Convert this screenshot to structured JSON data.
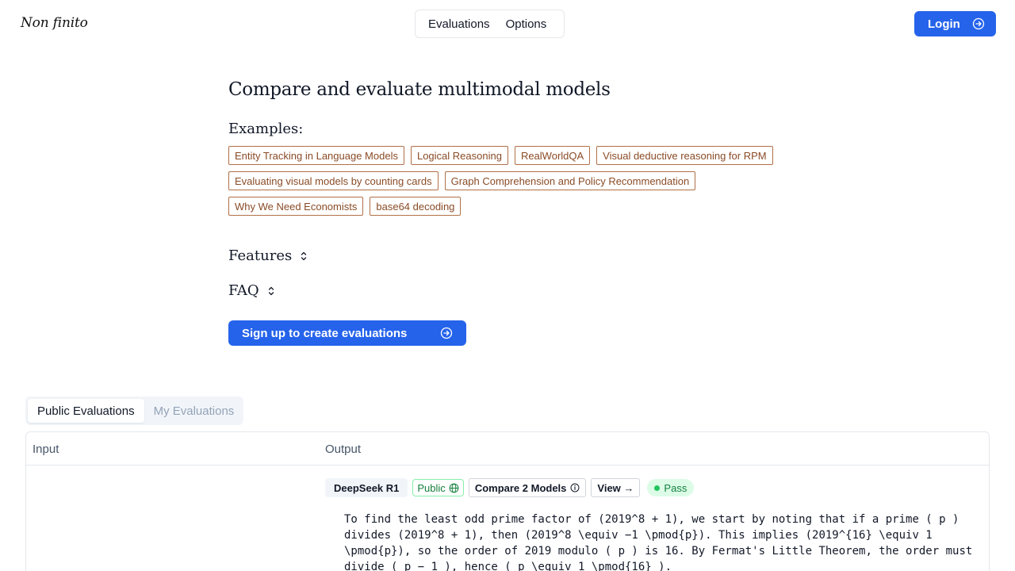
{
  "header": {
    "logo": "Non finito",
    "nav": [
      "Evaluations",
      "Options"
    ],
    "login_label": "Login"
  },
  "hero": {
    "title": "Compare and evaluate multimodal models",
    "examples_label": "Examples:",
    "examples": [
      "Entity Tracking in Language Models",
      "Logical Reasoning",
      "RealWorldQA",
      "Visual deductive reasoning for RPM",
      "Evaluating visual models by counting cards",
      "Graph Comprehension and Policy Recommendation",
      "Why We Need Economists",
      "base64 decoding"
    ],
    "features_label": "Features",
    "faq_label": "FAQ",
    "signup_label": "Sign up to create evaluations"
  },
  "tabs": [
    {
      "label": "Public Evaluations",
      "active": true
    },
    {
      "label": "My Evaluations",
      "active": false
    }
  ],
  "table": {
    "columns": [
      "Input",
      "Output"
    ],
    "rows": [
      {
        "model": "DeepSeek R1",
        "visibility": "Public",
        "compare_label": "Compare 2 Models",
        "view_label": "View →",
        "status": "Pass",
        "output": "To find the least odd prime factor of (2019^8 + 1), we start by noting that if a prime ( p )\ndivides (2019^8 + 1), then (2019^8 \\equiv −1 \\pmod{p}). This implies (2019^{16} \\equiv 1\n\\pmod{p}), so the order of 2019 modulo ( p ) is 16. By Fermat's Little Theorem, the order must\ndivide ( p − 1 ), hence ( p \\equiv 1 \\pmod{16} )."
      }
    ]
  },
  "colors": {
    "primary": "#2563eb",
    "chip_border": "#b07048",
    "chip_text": "#8a4b26",
    "pass_bg": "#dcfce7",
    "pass_text": "#15803d"
  }
}
